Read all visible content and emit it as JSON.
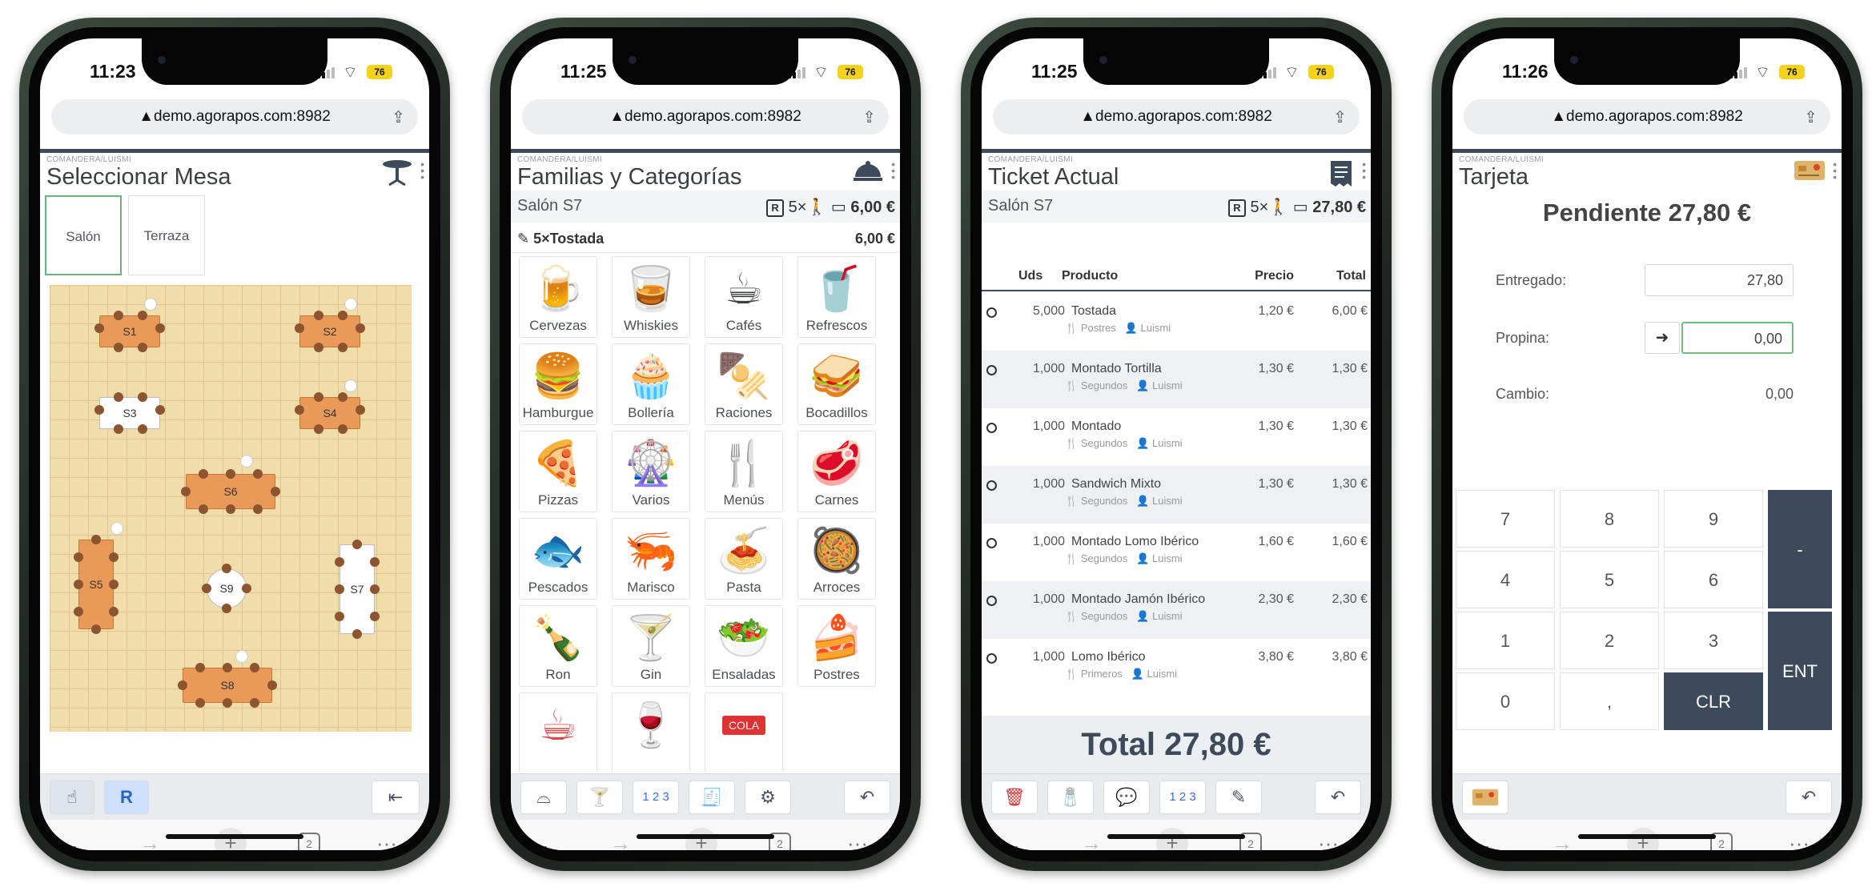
{
  "browser": {
    "url": "demo.agorapos.com:8982",
    "tabs_count": "2"
  },
  "crumb": "COMANDERA/LUISMI",
  "phones": [
    {
      "time": "11:23",
      "battery": "76",
      "title": "Seleccionar Mesa"
    },
    {
      "time": "11:25",
      "battery": "76",
      "title": "Familias y Categorías"
    },
    {
      "time": "11:25",
      "battery": "76",
      "title": "Ticket Actual"
    },
    {
      "time": "11:26",
      "battery": "76",
      "title": "Tarjeta"
    }
  ],
  "mesa": {
    "zones": [
      "Salón",
      "Terraza"
    ],
    "tables": [
      "S1",
      "S2",
      "S3",
      "S4",
      "S6",
      "S5",
      "S9",
      "S7",
      "S8"
    ]
  },
  "familias": {
    "place": "Salón S7",
    "r_badge": "R",
    "diners": "5×",
    "amount": "6,00 €",
    "last_line": "5×Tostada",
    "last_amount": "6,00 €",
    "categories": [
      {
        "label": "Cervezas",
        "icon": "beer-icon"
      },
      {
        "label": "Whiskies",
        "icon": "whisky-bottle-icon"
      },
      {
        "label": "Cafés",
        "icon": "coffee-cup-icon"
      },
      {
        "label": "Refrescos",
        "icon": "soda-cup-icon"
      },
      {
        "label": "Hamburgue",
        "icon": "burger-icon"
      },
      {
        "label": "Bollería",
        "icon": "cupcake-icon"
      },
      {
        "label": "Raciones",
        "icon": "tapas-icon"
      },
      {
        "label": "Bocadillos",
        "icon": "sandwich-icon"
      },
      {
        "label": "Pizzas",
        "icon": "pizza-icon"
      },
      {
        "label": "Varios",
        "icon": "roulette-icon"
      },
      {
        "label": "Menús",
        "icon": "menu-cutlery-icon"
      },
      {
        "label": "Carnes",
        "icon": "steak-icon"
      },
      {
        "label": "Pescados",
        "icon": "fish-icon"
      },
      {
        "label": "Marisco",
        "icon": "shrimp-icon"
      },
      {
        "label": "Pasta",
        "icon": "pasta-icon"
      },
      {
        "label": "Arroces",
        "icon": "paella-icon"
      },
      {
        "label": "Ron",
        "icon": "rum-bottle-icon"
      },
      {
        "label": "Gin",
        "icon": "gin-bottle-icon"
      },
      {
        "label": "Ensaladas",
        "icon": "salad-icon"
      },
      {
        "label": "Postres",
        "icon": "cake-icon"
      }
    ],
    "partial_row_label": "COLA"
  },
  "ticket": {
    "place": "Salón S7",
    "r_badge": "R",
    "diners": "5×",
    "amount": "27,80 €",
    "columns": {
      "uds": "Uds",
      "producto": "Producto",
      "precio": "Precio",
      "total": "Total"
    },
    "rows": [
      {
        "uds": "5,000",
        "product": "Tostada",
        "course": "Postres",
        "waiter": "Luismi",
        "price": "1,20 €",
        "total": "6,00 €"
      },
      {
        "uds": "1,000",
        "product": "Montado Tortilla",
        "course": "Segundos",
        "waiter": "Luismi",
        "price": "1,30 €",
        "total": "1,30 €"
      },
      {
        "uds": "1,000",
        "product": "Montado",
        "course": "Segundos",
        "waiter": "Luismi",
        "price": "1,30 €",
        "total": "1,30 €"
      },
      {
        "uds": "1,000",
        "product": "Sandwich Mixto",
        "course": "Segundos",
        "waiter": "Luismi",
        "price": "1,30 €",
        "total": "1,30 €"
      },
      {
        "uds": "1,000",
        "product": "Montado Lomo Ibérico",
        "course": "Segundos",
        "waiter": "Luismi",
        "price": "1,60 €",
        "total": "1,60 €"
      },
      {
        "uds": "1,000",
        "product": "Montado Jamón Ibérico",
        "course": "Segundos",
        "waiter": "Luismi",
        "price": "2,30 €",
        "total": "2,30 €"
      },
      {
        "uds": "1,000",
        "product": "Lomo Ibérico",
        "course": "Primeros",
        "waiter": "Luismi",
        "price": "3,80 €",
        "total": "3,80 €"
      }
    ],
    "total_label": "Total 27,80 €"
  },
  "tarjeta": {
    "pending": "Pendiente 27,80 €",
    "entregado_label": "Entregado:",
    "entregado_value": "27,80",
    "propina_label": "Propina:",
    "propina_value": "0,00",
    "cambio_label": "Cambio:",
    "cambio_value": "0,00",
    "keys": [
      "7",
      "8",
      "9",
      "4",
      "5",
      "6",
      "1",
      "2",
      "3",
      "0",
      ",",
      "CLR"
    ],
    "minus_key": "-",
    "ent_key": "ENT"
  },
  "colors": {
    "header_dark": "#3c4a5b",
    "floor": "#f1ddaa",
    "table_orange": "#ea9a58",
    "active_green": "#69b37d",
    "battery": "#f3d21b"
  }
}
